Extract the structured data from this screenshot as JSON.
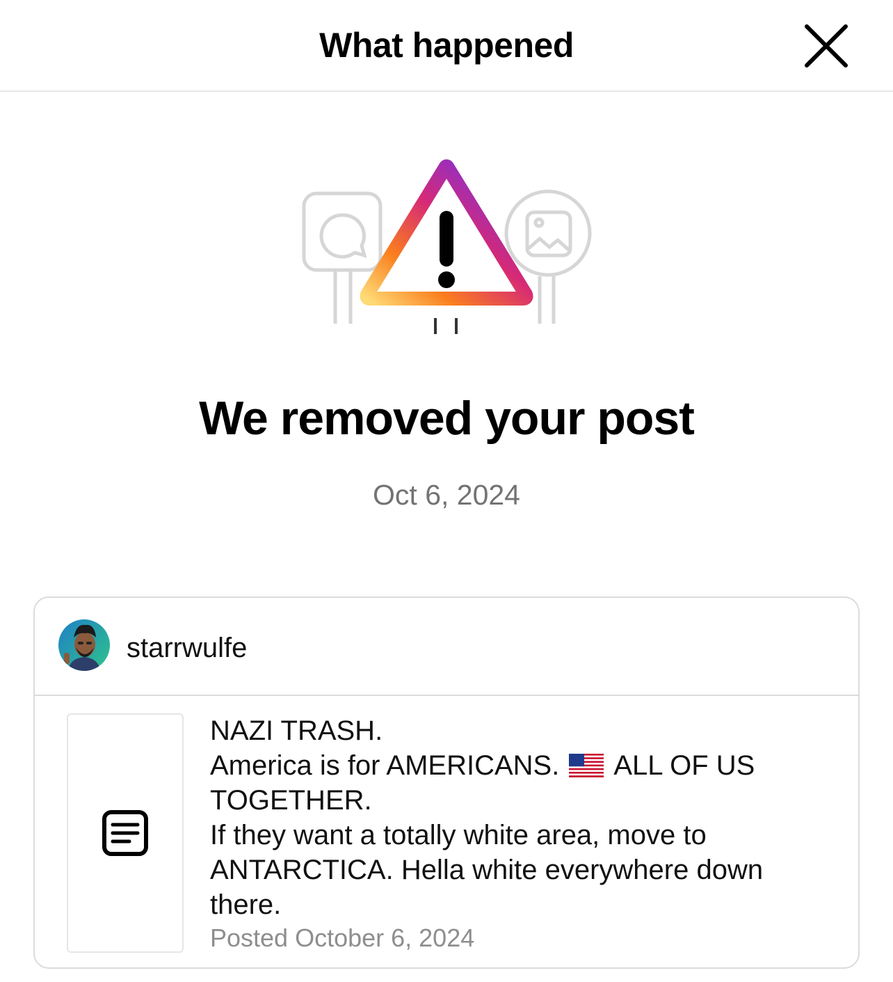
{
  "header": {
    "title": "What happened",
    "close_icon": "close-icon"
  },
  "illustration": {
    "icons": [
      "comment-sign-icon",
      "warning-triangle-icon",
      "image-sign-icon"
    ],
    "gradient_colors": [
      "#FEDA75",
      "#FA7E1E",
      "#D62976",
      "#962FBF",
      "#4F5BD5"
    ]
  },
  "main": {
    "headline": "We removed your post",
    "date": "Oct 6, 2024"
  },
  "post": {
    "username": "starrwulfe",
    "thumbnail_icon": "text-post-icon",
    "lines": {
      "l1": "NAZI TRASH.",
      "l2a": "America is for AMERICANS.",
      "l2_emoji": "us-flag-emoji",
      "l2b": "ALL OF US",
      "l3": "TOGETHER.",
      "l4": "If they want a totally white area, move to",
      "l5": "ANTARCTICA. Hella white everywhere down",
      "l6": "there."
    },
    "posted": "Posted October 6, 2024"
  }
}
